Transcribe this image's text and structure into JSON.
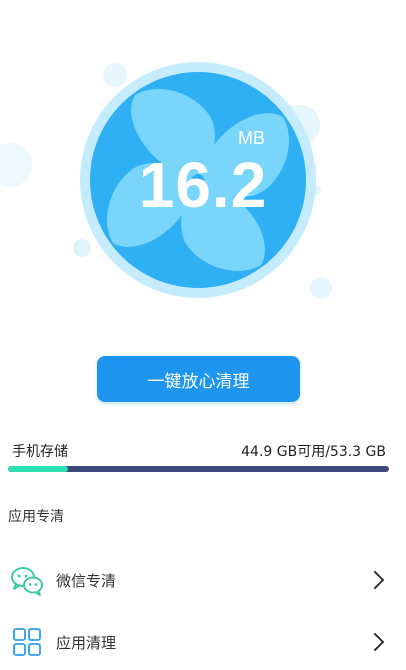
{
  "cleaner": {
    "junk_value": "16.2",
    "junk_unit": "MB",
    "clean_button_label": "一键放心清理"
  },
  "storage": {
    "label": "手机存储",
    "summary": "44.9 GB可用/53.3 GB",
    "used_fraction": 0.158
  },
  "section": {
    "title": "应用专清"
  },
  "items": [
    {
      "label": "微信专清",
      "icon": "wechat-icon"
    },
    {
      "label": "应用清理",
      "icon": "grid-apps-icon"
    }
  ],
  "colors": {
    "accent": "#1e96f0",
    "fan": "#6fd0fb",
    "storage_track": "#3b4a78",
    "storage_fill": "#2ee0b4",
    "wechat_green": "#2dc7a0",
    "apps_blue": "#2a9cf0"
  }
}
